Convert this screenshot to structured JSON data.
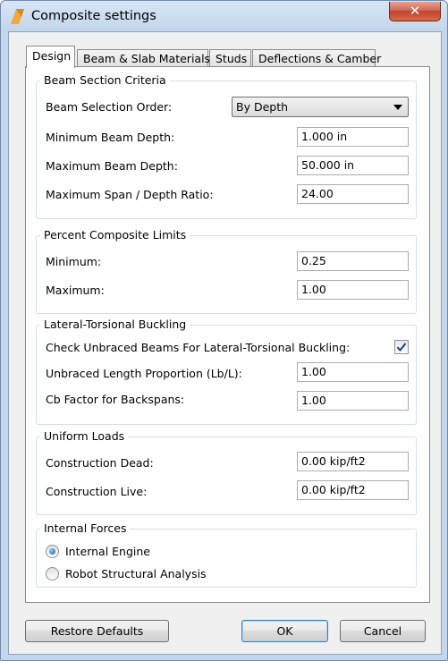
{
  "window": {
    "title": "Composite settings",
    "close_glyph": "✕",
    "app_icon": "autodesk-app-icon"
  },
  "tabs": [
    {
      "label": "Design",
      "active": true
    },
    {
      "label": "Beam & Slab Materials",
      "active": false
    },
    {
      "label": "Studs",
      "active": false
    },
    {
      "label": "Deflections & Camber",
      "active": false
    }
  ],
  "beam_section": {
    "title": "Beam Section Criteria",
    "order_label": "Beam Selection Order:",
    "order_value": "By Depth",
    "min_depth_label": "Minimum Beam Depth:",
    "min_depth_value": "1.000 in",
    "max_depth_label": "Maximum Beam Depth:",
    "max_depth_value": "50.000 in",
    "ratio_label": "Maximum Span / Depth Ratio:",
    "ratio_value": "24.00"
  },
  "percent_composite": {
    "title": "Percent Composite Limits",
    "min_label": "Minimum:",
    "min_value": "0.25",
    "max_label": "Maximum:",
    "max_value": "1.00"
  },
  "ltb": {
    "title": "Lateral-Torsional Buckling",
    "check_label": "Check Unbraced Beams For Lateral-Torsional Buckling:",
    "check_checked": true,
    "unbraced_label": "Unbraced Length Proportion (Lb/L):",
    "unbraced_value": "1.00",
    "cb_label": "Cb Factor for Backspans:",
    "cb_value": "1.00"
  },
  "uniform_loads": {
    "title": "Uniform Loads",
    "dead_label": "Construction Dead:",
    "dead_value": "0.00 kip/ft2",
    "live_label": "Construction Live:",
    "live_value": "0.00 kip/ft2"
  },
  "internal_forces": {
    "title": "Internal Forces",
    "option1": "Internal Engine",
    "option2": "Robot Structural Analysis",
    "selected": "Internal Engine"
  },
  "buttons": {
    "restore": "Restore Defaults",
    "ok": "OK",
    "cancel": "Cancel"
  },
  "colors": {
    "title_bar": "#c2d5eb",
    "close": "#c2432a",
    "panel": "#ffffff",
    "client": "#f0f0f0",
    "radio_on": "#0f5fa8"
  }
}
